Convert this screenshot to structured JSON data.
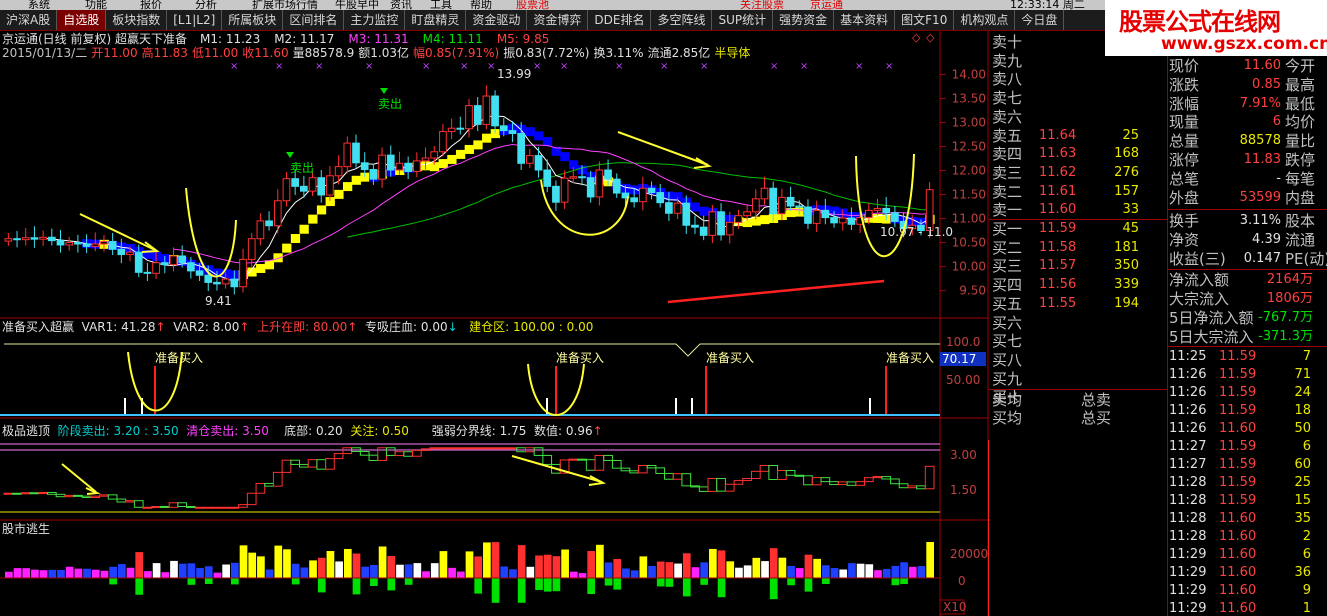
{
  "window": {
    "menu_items": [
      "系统",
      "功能",
      "报价",
      "分析",
      "扩展市场行情",
      "牛股早中",
      "资讯",
      "工具",
      "帮助"
    ],
    "badge": "股票池",
    "notice": "关注股票",
    "notice2": "京运通",
    "datetime": "12:33:14 周二"
  },
  "tabs": [
    "沪深A股",
    "自选股",
    "板块指数",
    "[L1|L2]",
    "所属板块",
    "区间排名",
    "主力监控",
    "盯盘精灵",
    "资金驱动",
    "资金博弈",
    "DDE排名",
    "多空阵线",
    "SUP统计",
    "强势资金",
    "基本资料",
    "图文F10",
    "机构观点",
    "今日盘"
  ],
  "logo": {
    "line1": "股票公式在线网",
    "line2": "www.gszx.com.cn"
  },
  "main": {
    "title": "京运通(日线 前复权)  超赢天下准备",
    "ma": [
      {
        "label": "M1: 11.23",
        "color": "#e0e0e0"
      },
      {
        "label": "M2: 11.17",
        "color": "#e0e0e0"
      },
      {
        "label": "M3: 11.31",
        "color": "#ff40ff"
      },
      {
        "label": "M4: 11.11",
        "color": "#00e000"
      },
      {
        "label": "M5: 9.85",
        "color": "#ff4040"
      }
    ],
    "info": {
      "date": "2015/01/13/二",
      "open": "开11.00",
      "high": "高11.83",
      "low": "低11.00",
      "close": "收11.60",
      "vol": "量88578.9",
      "amt": "额1.03亿",
      "chg": "幅0.85(7.91%)",
      "amp": "振0.83(7.72%)",
      "turn": "换3.11%",
      "float": "流通2.85亿",
      "sector": "半导体"
    },
    "y_ticks": [
      "14.00",
      "13.50",
      "13.00",
      "12.50",
      "12.00",
      "11.50",
      "11.00",
      "10.50",
      "10.00",
      "9.50"
    ],
    "labels": {
      "high": "13.99",
      "low": "9.41",
      "cur": "10.97 - 11.0",
      "sell1": "卖出",
      "sell2": "卖出"
    }
  },
  "chart_data": {
    "type": "candlestick",
    "series_name": "京运通",
    "ylim": [
      9.2,
      14.3
    ],
    "close": [
      10.58,
      10.56,
      10.6,
      10.57,
      10.61,
      10.54,
      10.45,
      10.5,
      10.47,
      10.42,
      10.47,
      10.52,
      10.36,
      10.25,
      10.3,
      9.88,
      9.86,
      10.08,
      10.04,
      10.22,
      10.08,
      9.91,
      9.82,
      9.67,
      9.64,
      9.74,
      9.58,
      10.15,
      10.58,
      10.95,
      10.85,
      11.37,
      11.83,
      11.67,
      11.57,
      11.85,
      11.49,
      11.89,
      12.08,
      12.57,
      12.16,
      12.02,
      11.82,
      12.32,
      12.01,
      12.15,
      11.98,
      12.2,
      12.26,
      12.39,
      12.81,
      12.88,
      12.87,
      13.35,
      12.96,
      13.55,
      12.93,
      12.83,
      12.77,
      12.15,
      12.31,
      12.01,
      11.67,
      11.34,
      11.84,
      11.87,
      11.85,
      11.45,
      12.01,
      11.82,
      11.53,
      11.43,
      11.35,
      11.63,
      11.54,
      11.33,
      11.11,
      11.32,
      10.86,
      10.82,
      10.65,
      11.14,
      10.66,
      10.92,
      11.06,
      11.14,
      11.41,
      11.63,
      11.1,
      11.44,
      11.26,
      11.24,
      10.9,
      11.17,
      11.02,
      10.91,
      11.01,
      10.88,
      11.02,
      11.17,
      11.21,
      11.12,
      10.94,
      10.79,
      10.86,
      10.75,
      11.6
    ],
    "volume_subchart_y_ticks": [
      "20000",
      "0"
    ],
    "sub1": {
      "title": "准备买入超赢",
      "var1": "VAR1: 41.28",
      "var2": "VAR2: 8.00",
      "up": "上升在即: 80.00",
      "zx": "专吸庄血: 0.00",
      "jc": "建仓区: 100.00 : 0.00",
      "y_ticks": [
        "100.0",
        "50.00"
      ],
      "marker": "70.17",
      "buy": "准备买入"
    },
    "sub2": {
      "title": "极品逃顶",
      "a": "阶段卖出: 3.20 : 3.50",
      "b": "清仓卖出: 3.50",
      "c": "底部: 0.20",
      "d": "关注: 0.50",
      "e": "强弱分界线: 1.75",
      "f": "数值: 0.96",
      "y_ticks": [
        "3.00",
        "1.50"
      ]
    },
    "sub3": {
      "title": "股市逃生"
    },
    "x10": "X10"
  },
  "quote": {
    "sells": [
      {
        "l": "卖十",
        "p": "",
        "v": ""
      },
      {
        "l": "卖九",
        "p": "",
        "v": ""
      },
      {
        "l": "卖八",
        "p": "",
        "v": ""
      },
      {
        "l": "卖七",
        "p": "",
        "v": ""
      },
      {
        "l": "卖六",
        "p": "",
        "v": ""
      },
      {
        "l": "卖五",
        "p": "11.64",
        "v": "25"
      },
      {
        "l": "卖四",
        "p": "11.63",
        "v": "168"
      },
      {
        "l": "卖三",
        "p": "11.62",
        "v": "276"
      },
      {
        "l": "卖二",
        "p": "11.61",
        "v": "157"
      },
      {
        "l": "卖一",
        "p": "11.60",
        "v": "33"
      }
    ],
    "buys": [
      {
        "l": "买一",
        "p": "11.59",
        "v": "45"
      },
      {
        "l": "买二",
        "p": "11.58",
        "v": "181"
      },
      {
        "l": "买三",
        "p": "11.57",
        "v": "350"
      },
      {
        "l": "买四",
        "p": "11.56",
        "v": "339"
      },
      {
        "l": "买五",
        "p": "11.55",
        "v": "194"
      },
      {
        "l": "买六",
        "p": "",
        "v": ""
      },
      {
        "l": "买七",
        "p": "",
        "v": ""
      },
      {
        "l": "买八",
        "p": "",
        "v": ""
      },
      {
        "l": "买九",
        "p": "",
        "v": ""
      },
      {
        "l": "买十",
        "p": "",
        "v": ""
      }
    ],
    "avg": [
      {
        "l": "卖均",
        "r": "总卖"
      },
      {
        "l": "买均",
        "r": "总买"
      }
    ],
    "stats": [
      {
        "a": "现价",
        "b": "11.60",
        "c": "今开",
        "bc": "red"
      },
      {
        "a": "涨跌",
        "b": "0.85",
        "c": "最高",
        "bc": "red"
      },
      {
        "a": "涨幅",
        "b": "7.91%",
        "c": "最低",
        "bc": "red"
      },
      {
        "a": "现量",
        "b": "6",
        "c": "均价",
        "bc": "red"
      },
      {
        "a": "总量",
        "b": "88578",
        "c": "量比",
        "bc": "yel"
      },
      {
        "a": "涨停",
        "b": "11.83",
        "c": "跌停",
        "bc": "red"
      },
      {
        "a": "总笔",
        "b": "-",
        "c": "每笔",
        "bc": "wht"
      },
      {
        "a": "外盘",
        "b": "53599",
        "c": "内盘",
        "bc": "red"
      }
    ],
    "fin": [
      {
        "a": "换手",
        "b": "3.11%",
        "c": "股本",
        "bc": "yel"
      },
      {
        "a": "净资",
        "b": "4.39",
        "c": "流通",
        "bc": "yel"
      },
      {
        "a": "收益(三)",
        "b": "0.147",
        "c": "PE(动)",
        "bc": "yel"
      }
    ],
    "flow": [
      {
        "a": "净流入额",
        "b": "2164万",
        "bc": "red"
      },
      {
        "a": "大宗流入",
        "b": "1806万",
        "bc": "red"
      },
      {
        "a": "5日净流入额",
        "b": "-767.7万",
        "bc": "grn"
      },
      {
        "a": "5日大宗流入",
        "b": "-371.3万",
        "bc": "grn"
      }
    ],
    "ticks": [
      {
        "t": "11:25",
        "p": "11.59",
        "v": "7"
      },
      {
        "t": "11:26",
        "p": "11.59",
        "v": "71"
      },
      {
        "t": "11:26",
        "p": "11.59",
        "v": "24"
      },
      {
        "t": "11:26",
        "p": "11.59",
        "v": "18"
      },
      {
        "t": "11:26",
        "p": "11.60",
        "v": "50"
      },
      {
        "t": "11:27",
        "p": "11.59",
        "v": "6"
      },
      {
        "t": "11:27",
        "p": "11.59",
        "v": "60"
      },
      {
        "t": "11:28",
        "p": "11.59",
        "v": "25"
      },
      {
        "t": "11:28",
        "p": "11.59",
        "v": "15"
      },
      {
        "t": "11:28",
        "p": "11.60",
        "v": "35"
      },
      {
        "t": "11:28",
        "p": "11.60",
        "v": "2"
      },
      {
        "t": "11:29",
        "p": "11.60",
        "v": "6"
      },
      {
        "t": "11:29",
        "p": "11.60",
        "v": "36"
      },
      {
        "t": "11:29",
        "p": "11.60",
        "v": "9"
      },
      {
        "t": "11:29",
        "p": "11.60",
        "v": "1"
      }
    ]
  },
  "colors": {
    "up": "#ff3030",
    "down": "#40e0f0",
    "bg": "#000000",
    "axis": "#a00000"
  }
}
